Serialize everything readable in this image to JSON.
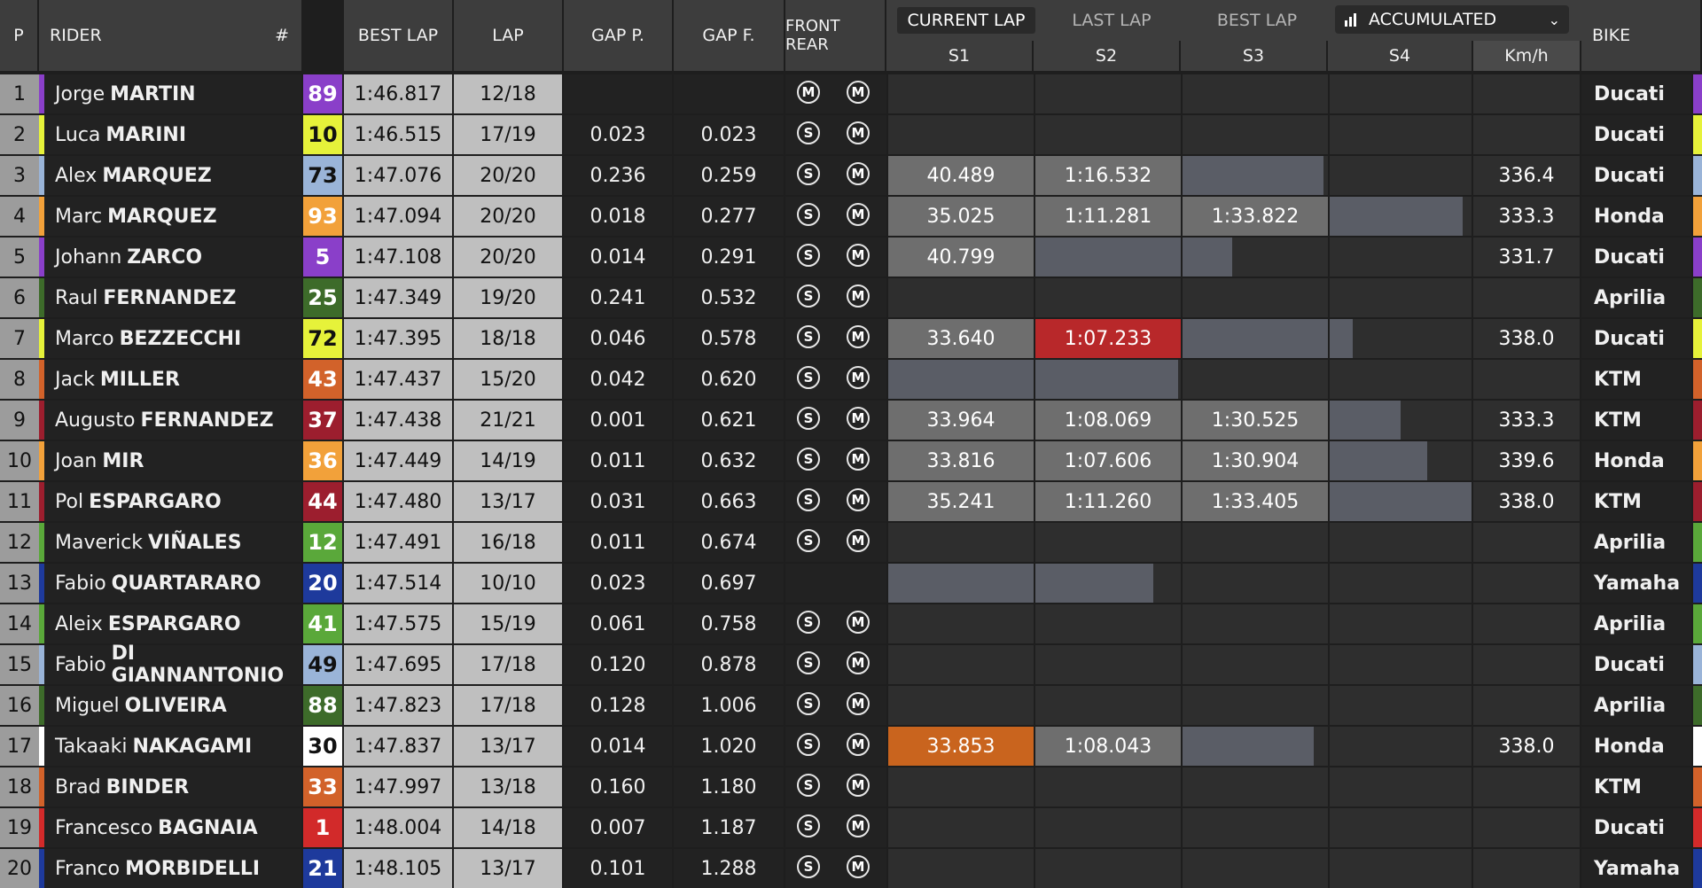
{
  "headers": {
    "pos": "P",
    "rider": "RIDER",
    "number": "#",
    "best_lap": "BEST LAP",
    "lap": "LAP",
    "gap_prev": "GAP P.",
    "gap_first": "GAP F.",
    "tyres": "FRONT REAR",
    "bike": "BIKE"
  },
  "sector_tabs": [
    "CURRENT LAP",
    "LAST LAP",
    "BEST LAP"
  ],
  "active_tab": "CURRENT LAP",
  "mode_dropdown": {
    "label": "ACCUMULATED",
    "icon": "bar-chart-icon"
  },
  "sector_columns": [
    "S1",
    "S2",
    "S3",
    "S4",
    "Km/h"
  ],
  "colors": {
    "sector_bar": "#5a5d66",
    "sector_done": "#6e6e6e",
    "best_overall": "#b8282a",
    "personal_best": "#c9641e"
  },
  "rows": [
    {
      "pos": "1",
      "first": "Jorge",
      "last": "MARTIN",
      "num": "89",
      "num_bg": "#8a3fc9",
      "num_fg": "#ffffff",
      "team": "#8a3fc9",
      "best": "1:46.817",
      "lap": "12/18",
      "gapp": "",
      "gapf": "",
      "front": "M",
      "rear": "M",
      "sectors": [
        null,
        null,
        null,
        null
      ],
      "speed": "",
      "bike": "Ducati"
    },
    {
      "pos": "2",
      "first": "Luca",
      "last": "MARINI",
      "num": "10",
      "num_bg": "#e6f23a",
      "num_fg": "#111111",
      "team": "#e6f23a",
      "best": "1:46.515",
      "lap": "17/19",
      "gapp": "0.023",
      "gapf": "0.023",
      "front": "S",
      "rear": "M",
      "sectors": [
        null,
        null,
        null,
        null
      ],
      "speed": "",
      "bike": "Ducati"
    },
    {
      "pos": "3",
      "first": "Alex",
      "last": "MARQUEZ",
      "num": "73",
      "num_bg": "#9ab4d8",
      "num_fg": "#111111",
      "team": "#9ab4d8",
      "best": "1:47.076",
      "lap": "20/20",
      "gapp": "0.236",
      "gapf": "0.259",
      "front": "S",
      "rear": "M",
      "sectors": [
        {
          "t": "40.489",
          "c": "done",
          "p": 1
        },
        {
          "t": "1:16.532",
          "c": "done",
          "p": 1
        },
        {
          "t": "",
          "c": "bar",
          "p": 0.97
        },
        null
      ],
      "speed": "336.4",
      "bike": "Ducati"
    },
    {
      "pos": "4",
      "first": "Marc",
      "last": "MARQUEZ",
      "num": "93",
      "num_bg": "#f2a13a",
      "num_fg": "#ffffff",
      "team": "#f2a13a",
      "best": "1:47.094",
      "lap": "20/20",
      "gapp": "0.018",
      "gapf": "0.277",
      "front": "S",
      "rear": "M",
      "sectors": [
        {
          "t": "35.025",
          "c": "done",
          "p": 1
        },
        {
          "t": "1:11.281",
          "c": "done",
          "p": 1
        },
        {
          "t": "1:33.822",
          "c": "done",
          "p": 1
        },
        {
          "t": "",
          "c": "bar",
          "p": 0.94
        }
      ],
      "speed": "333.3",
      "bike": "Honda"
    },
    {
      "pos": "5",
      "first": "Johann",
      "last": "ZARCO",
      "num": "5",
      "num_bg": "#8a3fc9",
      "num_fg": "#ffffff",
      "team": "#8a3fc9",
      "best": "1:47.108",
      "lap": "20/20",
      "gapp": "0.014",
      "gapf": "0.291",
      "front": "S",
      "rear": "M",
      "sectors": [
        {
          "t": "40.799",
          "c": "done",
          "p": 1
        },
        {
          "t": "",
          "c": "bar",
          "p": 1
        },
        {
          "t": "",
          "c": "bar",
          "p": 0.34
        },
        null
      ],
      "speed": "331.7",
      "bike": "Ducati"
    },
    {
      "pos": "6",
      "first": "Raul",
      "last": "FERNANDEZ",
      "num": "25",
      "num_bg": "#3d6b2a",
      "num_fg": "#ffffff",
      "team": "#3d6b2a",
      "best": "1:47.349",
      "lap": "19/20",
      "gapp": "0.241",
      "gapf": "0.532",
      "front": "S",
      "rear": "M",
      "sectors": [
        null,
        null,
        null,
        null
      ],
      "speed": "",
      "bike": "Aprilia"
    },
    {
      "pos": "7",
      "first": "Marco",
      "last": "BEZZECCHI",
      "num": "72",
      "num_bg": "#e6f23a",
      "num_fg": "#111111",
      "team": "#e6f23a",
      "best": "1:47.395",
      "lap": "18/18",
      "gapp": "0.046",
      "gapf": "0.578",
      "front": "S",
      "rear": "M",
      "sectors": [
        {
          "t": "33.640",
          "c": "done",
          "p": 1
        },
        {
          "t": "1:07.233",
          "c": "best",
          "p": 1
        },
        {
          "t": "",
          "c": "bar",
          "p": 1
        },
        {
          "t": "",
          "c": "bar",
          "p": 0.16
        }
      ],
      "speed": "338.0",
      "bike": "Ducati"
    },
    {
      "pos": "8",
      "first": "Jack",
      "last": "MILLER",
      "num": "43",
      "num_bg": "#d2622a",
      "num_fg": "#ffffff",
      "team": "#d2622a",
      "best": "1:47.437",
      "lap": "15/20",
      "gapp": "0.042",
      "gapf": "0.620",
      "front": "S",
      "rear": "M",
      "sectors": [
        {
          "t": "",
          "c": "bar",
          "p": 1
        },
        {
          "t": "",
          "c": "bar",
          "p": 0.98
        },
        null,
        null
      ],
      "speed": "",
      "bike": "KTM"
    },
    {
      "pos": "9",
      "first": "Augusto",
      "last": "FERNANDEZ",
      "num": "37",
      "num_bg": "#9c1e2e",
      "num_fg": "#ffffff",
      "team": "#9c1e2e",
      "best": "1:47.438",
      "lap": "21/21",
      "gapp": "0.001",
      "gapf": "0.621",
      "front": "S",
      "rear": "M",
      "sectors": [
        {
          "t": "33.964",
          "c": "done",
          "p": 1
        },
        {
          "t": "1:08.069",
          "c": "done",
          "p": 1
        },
        {
          "t": "1:30.525",
          "c": "done",
          "p": 1
        },
        {
          "t": "",
          "c": "bar",
          "p": 0.5
        }
      ],
      "speed": "333.3",
      "bike": "KTM"
    },
    {
      "pos": "10",
      "first": "Joan",
      "last": "MIR",
      "num": "36",
      "num_bg": "#f2a13a",
      "num_fg": "#ffffff",
      "team": "#f2a13a",
      "best": "1:47.449",
      "lap": "14/19",
      "gapp": "0.011",
      "gapf": "0.632",
      "front": "S",
      "rear": "M",
      "sectors": [
        {
          "t": "33.816",
          "c": "done",
          "p": 1
        },
        {
          "t": "1:07.606",
          "c": "done",
          "p": 1
        },
        {
          "t": "1:30.904",
          "c": "done",
          "p": 1
        },
        {
          "t": "",
          "c": "bar",
          "p": 0.69
        }
      ],
      "speed": "339.6",
      "bike": "Honda"
    },
    {
      "pos": "11",
      "first": "Pol",
      "last": "ESPARGARO",
      "num": "44",
      "num_bg": "#9c1e2e",
      "num_fg": "#ffffff",
      "team": "#9c1e2e",
      "best": "1:47.480",
      "lap": "13/17",
      "gapp": "0.031",
      "gapf": "0.663",
      "front": "S",
      "rear": "M",
      "sectors": [
        {
          "t": "35.241",
          "c": "done",
          "p": 1
        },
        {
          "t": "1:11.260",
          "c": "done",
          "p": 1
        },
        {
          "t": "1:33.405",
          "c": "done",
          "p": 1
        },
        {
          "t": "",
          "c": "bar",
          "p": 1
        }
      ],
      "speed": "338.0",
      "bike": "KTM"
    },
    {
      "pos": "12",
      "first": "Maverick",
      "last": "VIÑALES",
      "num": "12",
      "num_bg": "#5aa83a",
      "num_fg": "#ffffff",
      "team": "#5aa83a",
      "best": "1:47.491",
      "lap": "16/18",
      "gapp": "0.011",
      "gapf": "0.674",
      "front": "S",
      "rear": "M",
      "sectors": [
        null,
        null,
        null,
        null
      ],
      "speed": "",
      "bike": "Aprilia"
    },
    {
      "pos": "13",
      "first": "Fabio",
      "last": "QUARTARARO",
      "num": "20",
      "num_bg": "#1e3a9c",
      "num_fg": "#ffffff",
      "team": "#1e3a9c",
      "best": "1:47.514",
      "lap": "10/10",
      "gapp": "0.023",
      "gapf": "0.697",
      "front": "",
      "rear": "",
      "sectors": [
        {
          "t": "",
          "c": "bar",
          "p": 1
        },
        {
          "t": "",
          "c": "bar",
          "p": 0.81
        },
        null,
        null
      ],
      "speed": "",
      "bike": "Yamaha"
    },
    {
      "pos": "14",
      "first": "Aleix",
      "last": "ESPARGARO",
      "num": "41",
      "num_bg": "#5aa83a",
      "num_fg": "#ffffff",
      "team": "#5aa83a",
      "best": "1:47.575",
      "lap": "15/19",
      "gapp": "0.061",
      "gapf": "0.758",
      "front": "S",
      "rear": "M",
      "sectors": [
        null,
        null,
        null,
        null
      ],
      "speed": "",
      "bike": "Aprilia"
    },
    {
      "pos": "15",
      "first": "Fabio",
      "last": "DI GIANNANTONIO",
      "num": "49",
      "num_bg": "#9ab4d8",
      "num_fg": "#111111",
      "team": "#9ab4d8",
      "best": "1:47.695",
      "lap": "17/18",
      "gapp": "0.120",
      "gapf": "0.878",
      "front": "S",
      "rear": "M",
      "sectors": [
        null,
        null,
        null,
        null
      ],
      "speed": "",
      "bike": "Ducati"
    },
    {
      "pos": "16",
      "first": "Miguel",
      "last": "OLIVEIRA",
      "num": "88",
      "num_bg": "#3d6b2a",
      "num_fg": "#ffffff",
      "team": "#3d6b2a",
      "best": "1:47.823",
      "lap": "17/18",
      "gapp": "0.128",
      "gapf": "1.006",
      "front": "S",
      "rear": "M",
      "sectors": [
        null,
        null,
        null,
        null
      ],
      "speed": "",
      "bike": "Aprilia"
    },
    {
      "pos": "17",
      "first": "Takaaki",
      "last": "NAKAGAMI",
      "num": "30",
      "num_bg": "#ffffff",
      "num_fg": "#111111",
      "team": "#ffffff",
      "best": "1:47.837",
      "lap": "13/17",
      "gapp": "0.014",
      "gapf": "1.020",
      "front": "S",
      "rear": "M",
      "sectors": [
        {
          "t": "33.853",
          "c": "pb",
          "p": 1
        },
        {
          "t": "1:08.043",
          "c": "done",
          "p": 1
        },
        {
          "t": "",
          "c": "bar",
          "p": 0.9
        },
        null
      ],
      "speed": "338.0",
      "bike": "Honda"
    },
    {
      "pos": "18",
      "first": "Brad",
      "last": "BINDER",
      "num": "33",
      "num_bg": "#d2622a",
      "num_fg": "#ffffff",
      "team": "#d2622a",
      "best": "1:47.997",
      "lap": "13/18",
      "gapp": "0.160",
      "gapf": "1.180",
      "front": "S",
      "rear": "M",
      "sectors": [
        null,
        null,
        null,
        null
      ],
      "speed": "",
      "bike": "KTM"
    },
    {
      "pos": "19",
      "first": "Francesco",
      "last": "BAGNAIA",
      "num": "1",
      "num_bg": "#d22a2a",
      "num_fg": "#ffffff",
      "team": "#d22a2a",
      "best": "1:48.004",
      "lap": "14/18",
      "gapp": "0.007",
      "gapf": "1.187",
      "front": "S",
      "rear": "M",
      "sectors": [
        null,
        null,
        null,
        null
      ],
      "speed": "",
      "bike": "Ducati"
    },
    {
      "pos": "20",
      "first": "Franco",
      "last": "MORBIDELLI",
      "num": "21",
      "num_bg": "#1e3a9c",
      "num_fg": "#ffffff",
      "team": "#1e3a9c",
      "best": "1:48.105",
      "lap": "13/17",
      "gapp": "0.101",
      "gapf": "1.288",
      "front": "S",
      "rear": "M",
      "sectors": [
        null,
        null,
        null,
        null
      ],
      "speed": "",
      "bike": "Yamaha"
    }
  ]
}
